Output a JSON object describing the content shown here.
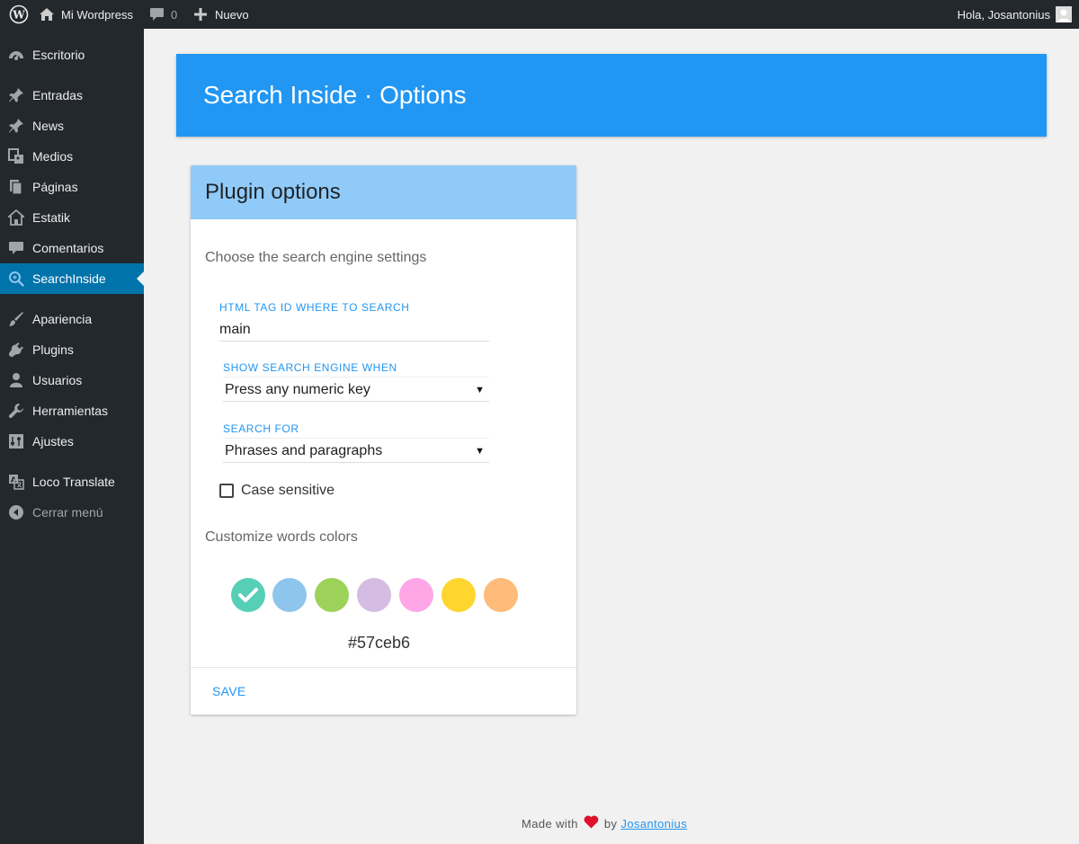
{
  "adminbar": {
    "site_name": "Mi Wordpress",
    "comments_count": "0",
    "new_label": "Nuevo",
    "greeting": "Hola, Josantonius"
  },
  "sidebar": {
    "items": [
      {
        "label": "Escritorio",
        "icon": "dashboard-icon"
      },
      {
        "label": "Entradas",
        "icon": "pin-icon"
      },
      {
        "label": "News",
        "icon": "pin-icon"
      },
      {
        "label": "Medios",
        "icon": "media-icon"
      },
      {
        "label": "Páginas",
        "icon": "pages-icon"
      },
      {
        "label": "Estatik",
        "icon": "home-icon"
      },
      {
        "label": "Comentarios",
        "icon": "comment-icon"
      },
      {
        "label": "SearchInside",
        "icon": "search-icon",
        "current": true
      },
      {
        "label": "Apariencia",
        "icon": "brush-icon"
      },
      {
        "label": "Plugins",
        "icon": "plugin-icon"
      },
      {
        "label": "Usuarios",
        "icon": "user-icon"
      },
      {
        "label": "Herramientas",
        "icon": "wrench-icon"
      },
      {
        "label": "Ajustes",
        "icon": "settings-icon"
      },
      {
        "label": "Loco Translate",
        "icon": "translate-icon"
      },
      {
        "label": "Cerrar menú",
        "icon": "collapse-icon"
      }
    ]
  },
  "header": {
    "title": "Search Inside · Options"
  },
  "card": {
    "title": "Plugin options",
    "subtitle": "Choose the search engine settings",
    "tag_id": {
      "label": "HTML TAG ID WHERE TO SEARCH",
      "value": "main"
    },
    "show_when": {
      "label": "SHOW SEARCH ENGINE WHEN",
      "value": "Press any numeric key"
    },
    "search_for": {
      "label": "SEARCH FOR",
      "value": "Phrases and paragraphs"
    },
    "case_sensitive_label": "Case sensitive",
    "case_sensitive_checked": false,
    "colors_label": "Customize words colors",
    "colors": [
      "#57ceb6",
      "#8ec5ec",
      "#9dd25a",
      "#d5bce3",
      "#ffa6e7",
      "#ffd52e",
      "#ffbb7a"
    ],
    "selected_color": "#57ceb6",
    "save_label": "SAVE"
  },
  "footer": {
    "made_with": "Made with",
    "by": "by",
    "author": "Josantonius",
    "heart_color": "#e0102b"
  },
  "theme": {
    "accent": "#2196f3",
    "header_light": "#90caf9",
    "admin_dark": "#23282d",
    "current_menu": "#0073aa"
  }
}
